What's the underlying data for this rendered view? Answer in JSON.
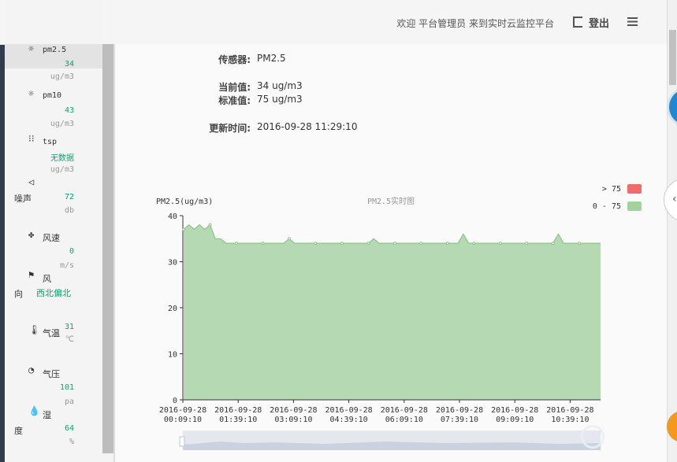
{
  "header": {
    "welcome": "欢迎 平台管理员 来到实时云监控平台",
    "logout_label": "登出",
    "logout_icon": "logout-icon",
    "menu_icon": "menu-icon"
  },
  "sidebar": {
    "items": [
      {
        "icon": "sun-icon",
        "name": "pm2.5",
        "value": "34",
        "unit": "ug/m3"
      },
      {
        "icon": "sun-icon",
        "name": "pm10",
        "value": "43",
        "unit": "ug/m3"
      },
      {
        "icon": "dust-icon",
        "name": "tsp",
        "value": "无数据",
        "unit": "ug/m3"
      },
      {
        "icon": "speaker-icon",
        "name": "噪声",
        "value": "72",
        "unit": "db"
      },
      {
        "icon": "fan-icon",
        "name": "风速",
        "value": "0",
        "unit": "m/s"
      },
      {
        "icon": "flag-icon",
        "name_a": "风",
        "name_b": "向",
        "value": "西北偏北"
      },
      {
        "icon": "thermometer-icon",
        "name": "气温",
        "value": "31",
        "unit": "℃"
      },
      {
        "icon": "gauge-icon",
        "name": "气压",
        "value": "101",
        "unit": "pa"
      },
      {
        "icon": "drop-icon",
        "name_a": "湿",
        "name_b": "度",
        "value": "64",
        "unit": "%"
      }
    ]
  },
  "detail": {
    "sensor_label": "传感器:",
    "sensor_value": "PM2.5",
    "current_label": "当前值:",
    "current_value": "34 ug/m3",
    "standard_label": "标准值:",
    "standard_value": "75 ug/m3",
    "updated_label": "更新时间:",
    "updated_value": "2016-09-28 11:29:10"
  },
  "chart_data": {
    "type": "area",
    "title": "PM2.5实时图",
    "ylabel": "PM2.5(ug/m3)",
    "ylim": [
      0,
      40
    ],
    "yticks": [
      0,
      10,
      20,
      30,
      40
    ],
    "xticks": [
      [
        "2016-09-28",
        "00:09:10"
      ],
      [
        "2016-09-28",
        "01:39:10"
      ],
      [
        "2016-09-28",
        "03:09:10"
      ],
      [
        "2016-09-28",
        "04:39:10"
      ],
      [
        "2016-09-28",
        "06:09:10"
      ],
      [
        "2016-09-28",
        "07:39:10"
      ],
      [
        "2016-09-28",
        "09:09:10"
      ],
      [
        "2016-09-28",
        "10:39:10"
      ]
    ],
    "legend": [
      {
        "label": "> 75",
        "color": "#f26b6b"
      },
      {
        "label": "0 - 75",
        "color": "#a3d39c"
      }
    ],
    "legend_position": "top-right",
    "area_color": "#b5d9b3",
    "line_color": "#8cc58a",
    "series": [
      {
        "values": [
          37,
          38,
          37,
          38,
          37,
          38,
          35,
          35,
          34,
          34,
          34,
          34,
          34,
          34,
          34,
          34,
          34,
          34,
          34,
          34,
          35,
          34,
          34,
          34,
          34,
          34,
          34,
          34,
          34,
          34,
          34,
          34,
          34,
          34,
          34,
          34,
          35,
          34,
          34,
          34,
          34,
          34,
          34,
          34,
          34,
          34,
          34,
          34,
          34,
          34,
          34,
          34,
          34,
          36,
          34,
          34,
          34,
          34,
          34,
          34,
          34,
          34,
          34,
          34,
          34,
          34,
          34,
          34,
          34,
          34,
          34,
          36,
          34,
          34,
          34,
          34,
          34,
          34,
          34,
          34
        ]
      }
    ]
  }
}
